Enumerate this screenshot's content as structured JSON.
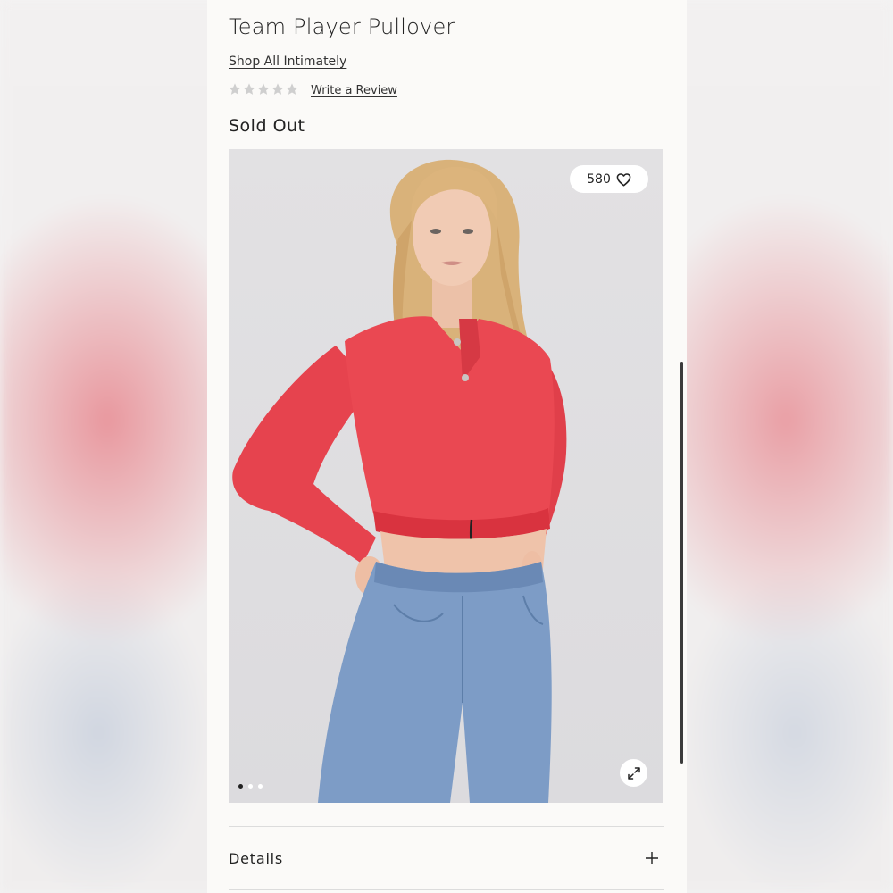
{
  "product": {
    "title": "Team Player Pullover",
    "brand_link": "Shop All Intimately",
    "rating_stars": 0,
    "rating_max": 5,
    "review_link": "Write a Review",
    "availability": "Sold Out"
  },
  "gallery": {
    "like_count": "580",
    "slide_count": 3,
    "active_slide": 1
  },
  "accordion": {
    "details_label": "Details"
  },
  "icons": {
    "favorite": "heart-icon",
    "expand": "expand-icon",
    "accordion_toggle": "plus-icon",
    "rating": "star-icon"
  },
  "colors": {
    "star_empty": "#cfcfcf",
    "pullover": "#e8474f",
    "jeans": "#7d9cc6"
  }
}
